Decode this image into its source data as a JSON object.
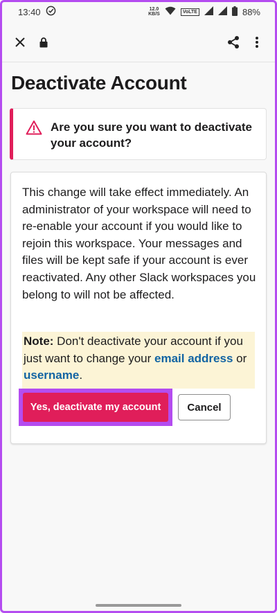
{
  "status_bar": {
    "time": "13:40",
    "net_speed_value": "12.0",
    "net_speed_unit": "KB/S",
    "volte_label": "VoLTE",
    "battery": "88%"
  },
  "toolbar": {
    "close_icon": "close-icon",
    "lock_icon": "lock-icon",
    "share_icon": "share-icon",
    "more_icon": "more-vert-icon"
  },
  "page": {
    "title": "Deactivate Account",
    "alert": {
      "icon": "warning-icon",
      "text": "Are you sure you want to deactivate your account?"
    },
    "body": "This change will take effect immediately. An administrator of your workspace will need to re-enable your account if you would like to rejoin this workspace. Your messages and files will be kept safe if your account is ever reactivated. Any other Slack workspaces you belong to will not be affected.",
    "note": {
      "label": "Note:",
      "text_before": " Don't deactivate your account if you just want to change your ",
      "link_email": "email address",
      "text_or": " or ",
      "link_username": "username",
      "text_end": "."
    },
    "buttons": {
      "deactivate": "Yes, deactivate my account",
      "cancel": "Cancel"
    }
  },
  "colors": {
    "danger": "#e01e5a",
    "link": "#1264a3",
    "note_bg": "#fcf4d6",
    "highlight": "#b44cf0"
  }
}
